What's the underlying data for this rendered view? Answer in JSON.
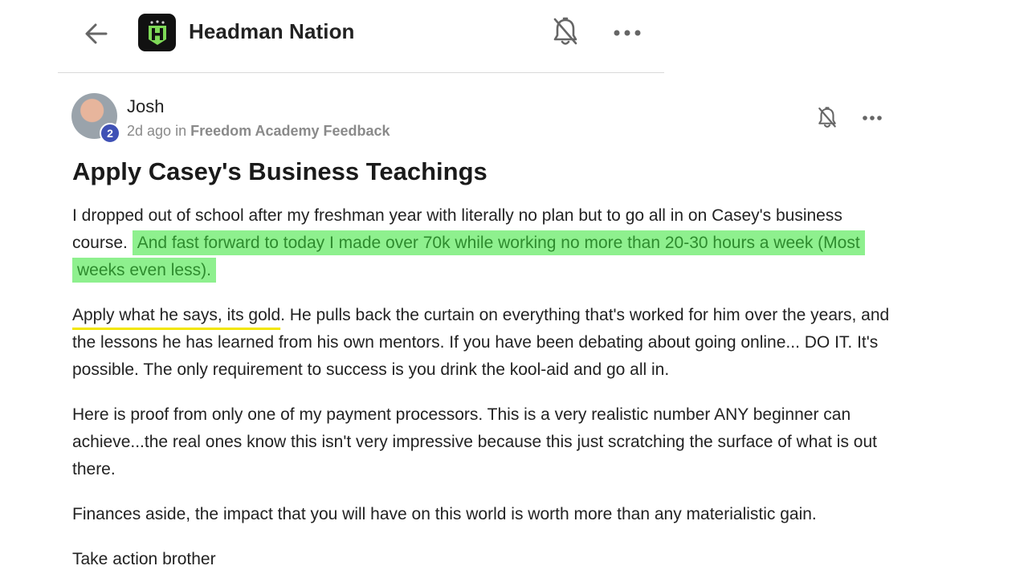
{
  "header": {
    "group_name": "Headman Nation",
    "back_icon": "arrow-left-icon",
    "logo_icon": "headman-logo",
    "bell_icon": "bell-off-icon",
    "more_icon": "more-horizontal-icon"
  },
  "post": {
    "author": "Josh",
    "level": "2",
    "time_ago": "2d ago",
    "in_label": "in",
    "category": "Freedom Academy Feedback",
    "title": "Apply Casey's Business Teachings",
    "p1_plain": "I dropped out of school after my freshman year with literally no plan but to go all in on Casey's business course. ",
    "p1_highlight": "And fast forward to today I made over 70k while working no more than 20-30 hours a week (Most weeks even less).",
    "p2_underlined": "Apply what he says, its gold",
    "p2_rest": ". He pulls back the curtain on everything that's worked for him over the years, and the lessons he has learned from his own mentors. If you have been debating about going online... DO IT. It's possible. The only requirement to success is you drink the kool-aid and go all in.",
    "p3": "Here is proof from only one of my payment processors. This is a very realistic number ANY beginner can achieve...the real ones know this isn't very impressive because this just scratching the surface of what is out there.",
    "p4": "Finances aside, the impact that you will have on this world is worth more than any materialistic gain.",
    "p5": "Take action brother"
  },
  "colors": {
    "highlight_bg": "#8ef08e",
    "highlight_text": "#2e8b2e",
    "underline": "#f2e600",
    "badge": "#3f51b5"
  }
}
